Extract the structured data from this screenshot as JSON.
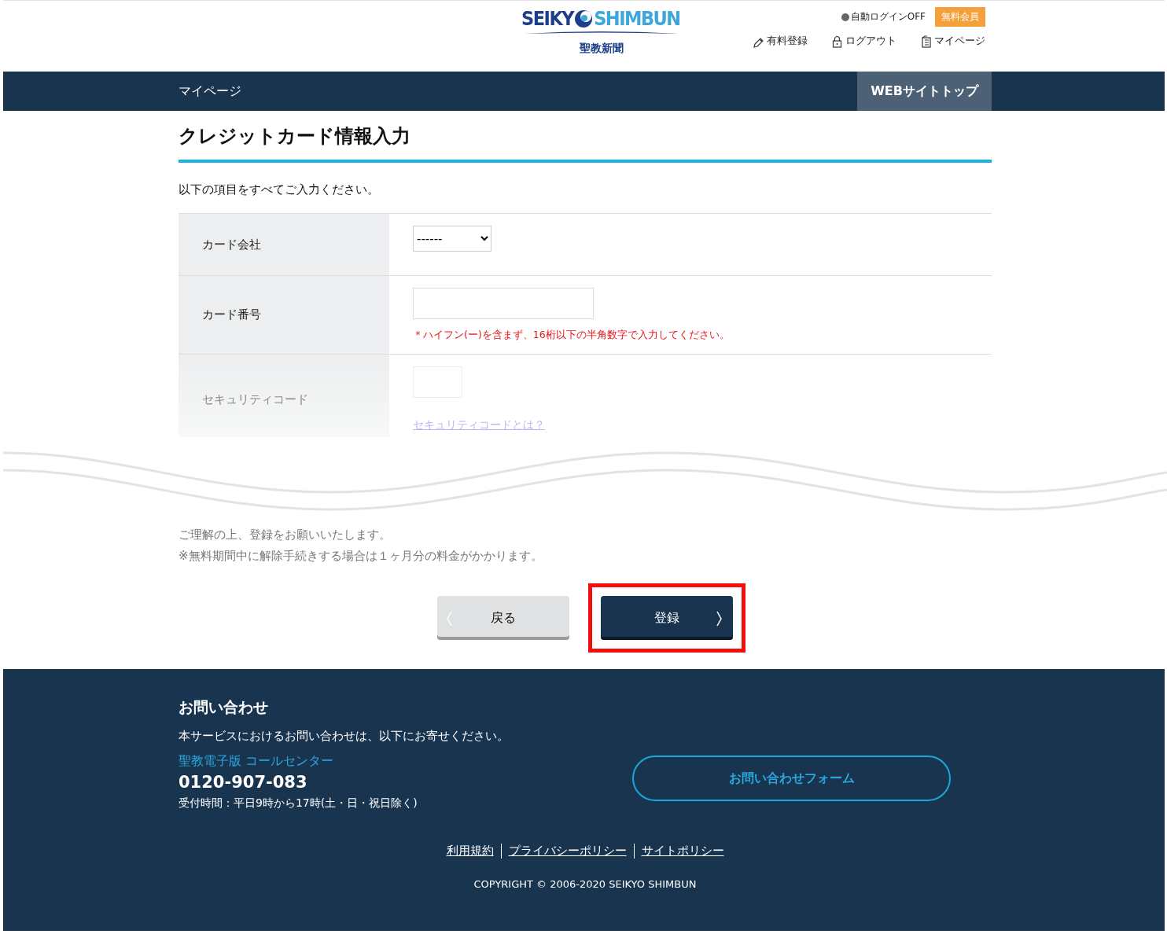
{
  "header": {
    "logo_left": "SEIKY",
    "logo_right": "SHIMBUN",
    "logo_subtitle": "聖教新聞",
    "auto_login": "自動ログインOFF",
    "member_badge": "無料会員",
    "links": [
      {
        "label": "有料登録",
        "kind": "register"
      },
      {
        "label": "ログアウト",
        "kind": "logout"
      },
      {
        "label": "マイページ",
        "kind": "mypage"
      }
    ]
  },
  "nav": {
    "title": "マイページ",
    "top_link": "WEBサイトトップ"
  },
  "page_title": "クレジットカード情報入力",
  "intro": "以下の項目をすべてご入力ください。",
  "form_rows": [
    {
      "label": "カード会社",
      "kind": "select",
      "value": "------"
    },
    {
      "label": "カード番号",
      "kind": "text",
      "note": "＊ハイフン(ー)を含まず、16桁以下の半角数字で入力してください。"
    },
    {
      "label": "セキュリティコード",
      "kind": "short",
      "link": "セキュリティコードとは？"
    }
  ],
  "notice": [
    "ご理解の上、登録をお願いいたします。",
    "※無料期間中に解除手続きする場合は１ヶ月分の料金がかかります。"
  ],
  "buttons": [
    {
      "label": "戻る",
      "kind": "back",
      "highlighted": false
    },
    {
      "label": "登録",
      "kind": "submit",
      "highlighted": true
    }
  ],
  "footer": {
    "heading": "お問い合わせ",
    "text": "本サービスにおけるお問い合わせは、以下にお寄せください。",
    "center": "聖教電子版 コールセンター",
    "phone": "0120-907-083",
    "hours": "受付時間：平日9時から17時(土・日・祝日除く)",
    "form_button": "お問い合わせフォーム",
    "links": [
      "利用規約",
      "プライバシーポリシー",
      "サイトポリシー"
    ],
    "copyright": "COPYRIGHT © 2006-2020 SEIKYO SHIMBUN"
  }
}
